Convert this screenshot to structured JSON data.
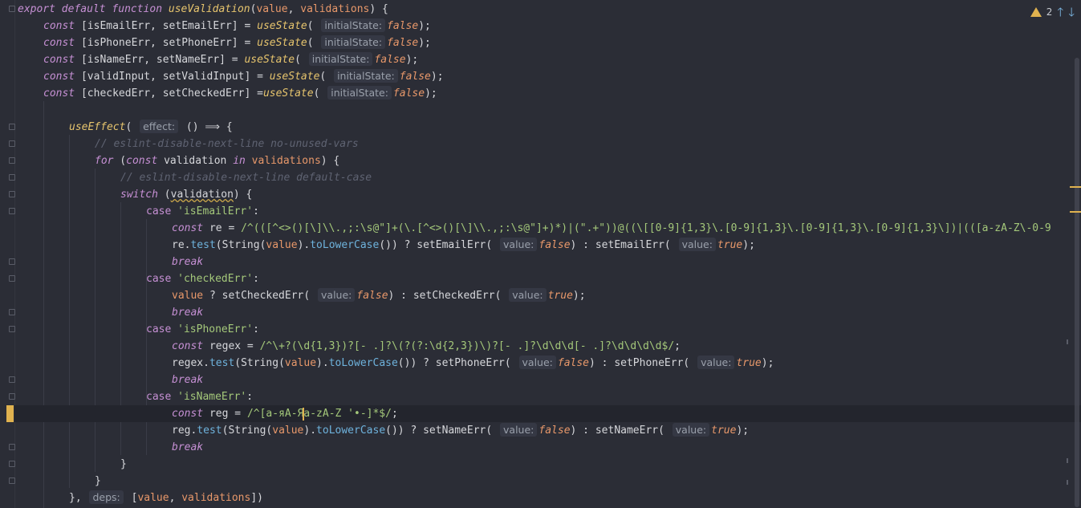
{
  "status": {
    "warning_count": "2",
    "warning_icon": "warning-triangle-icon",
    "up_icon": "arrow-up-icon",
    "down_icon": "arrow-down-icon",
    "up_glyph": "🡑",
    "down_glyph": "🡓"
  },
  "code": {
    "l1": {
      "a": "export",
      "b": "default",
      "c": "function",
      "d": "useValidation",
      "e": "(",
      "f": "value",
      ",": ", ",
      "g": "validations",
      "h": ") {"
    },
    "l2": {
      "k": "const",
      "v": " [isEmailErr, setEmailErr] = ",
      "f": "useState",
      "p": "( ",
      "h": "initialState:",
      "b": "false",
      "e": ");"
    },
    "l3": {
      "k": "const",
      "v": " [isPhoneErr, setPhoneErr] = ",
      "f": "useState",
      "p": "( ",
      "h": "initialState:",
      "b": "false",
      "e": ");"
    },
    "l4": {
      "k": "const",
      "v": " [isNameErr, setNameErr] = ",
      "f": "useState",
      "p": "( ",
      "h": "initialState:",
      "b": "false",
      "e": ");"
    },
    "l5": {
      "k": "const",
      "v": " [validInput, setValidInput] = ",
      "f": "useState",
      "p": "( ",
      "h": "initialState:",
      "b": "false",
      "e": ");"
    },
    "l6": {
      "k": "const",
      "v": " [checkedErr, setCheckedErr] =",
      "f": "useState",
      "p": "( ",
      "h": "initialState:",
      "b": "false",
      "e": ");"
    },
    "l8": {
      "f": "useEffect",
      "p": "( ",
      "h": "effect:",
      "e": " () ⟹ {"
    },
    "l9": {
      "c": "// eslint-disable-next-line no-unused-vars"
    },
    "l10": {
      "k": "for",
      "a": " (",
      "k2": "const",
      "v": " validation ",
      "k3": "in",
      "p": " validations",
      "e": ") {"
    },
    "l11": {
      "c": "// eslint-disable-next-line default-case"
    },
    "l12": {
      "k": "switch",
      "a": " (",
      "v": "validation",
      "e": ") {"
    },
    "l13": {
      "k": "case",
      "s": " 'isEmailErr'",
      "e": ":"
    },
    "l14": {
      "k": "const",
      "v": " re = ",
      "rx": "/^(([^<>()[\\]\\\\.,;:\\s@\"]+(\\.[^<>()[\\]\\\\.,;:\\s@\"]+)*)|(\".+\"))@((\\[[0-9]{1,3}\\.[0-9]{1,3}\\.[0-9]{1,3}\\.[0-9]{1,3}\\])|(([a-zA-Z\\-0-9"
    },
    "l15": {
      "a": "re.",
      "m": "test",
      "b": "(String(",
      "p": "value",
      "c": ").",
      "m2": "toLowerCase",
      "d": "()) ? setEmailErr( ",
      "h": "value:",
      "bf": "false",
      "e": ") : setEmailErr( ",
      "h2": "value:",
      "bt": "true",
      "z": ");"
    },
    "l16": {
      "k": "break"
    },
    "l17": {
      "k": "case",
      "s": " 'checkedErr'",
      "e": ":"
    },
    "l18": {
      "p": "value",
      "a": " ? setCheckedErr( ",
      "h": "value:",
      "bf": "false",
      "e": ") : setCheckedErr( ",
      "h2": "value:",
      "bt": "true",
      "z": ");"
    },
    "l19": {
      "k": "break"
    },
    "l20": {
      "k": "case",
      "s": " 'isPhoneErr'",
      "e": ":"
    },
    "l21": {
      "k": "const",
      "v": " regex = ",
      "rx": "/^\\+?(\\d{1,3})?[- .]?\\(?(?:\\d{2,3})\\)?[- .]?\\d\\d\\d[- .]?\\d\\d\\d\\d$/",
      "e": ";"
    },
    "l22": {
      "a": "regex.",
      "m": "test",
      "b": "(String(",
      "p": "value",
      "c": ").",
      "m2": "toLowerCase",
      "d": "()) ? setPhoneErr( ",
      "h": "value:",
      "bf": "false",
      "e": ") : setPhoneErr( ",
      "h2": "value:",
      "bt": "true",
      "z": ");"
    },
    "l23": {
      "k": "break"
    },
    "l24": {
      "k": "case",
      "s": " 'isNameErr'",
      "e": ":"
    },
    "l25": {
      "k": "const",
      "v": " reg = ",
      "rx1": "/^[а-яА-Я",
      "rx2": "a-zA-Z '•-]*$/",
      "e": ";"
    },
    "l26": {
      "a": "reg.",
      "m": "test",
      "b": "(String(",
      "p": "value",
      "c": ").",
      "m2": "toLowerCase",
      "d": "()) ? setNameErr( ",
      "h": "value:",
      "bf": "false",
      "e": ") : setNameErr( ",
      "h2": "value:",
      "bt": "true",
      "z": ");"
    },
    "l27": {
      "k": "break"
    },
    "l28": {
      "e": "}"
    },
    "l29": {
      "e": "}"
    },
    "l30": {
      "a": "}, ",
      "h": "deps:",
      "b": " [",
      "p": "value",
      ",": ", ",
      "p2": "validations",
      "e": "])"
    }
  }
}
